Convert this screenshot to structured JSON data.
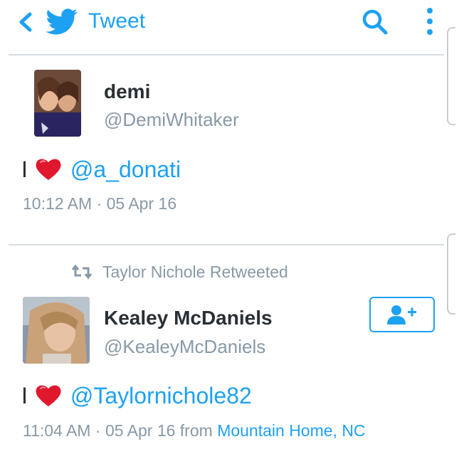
{
  "header": {
    "title": "Tweet",
    "back_icon": "chevron-left-icon",
    "logo_icon": "twitter-bird-icon",
    "search_icon": "search-icon",
    "more_icon": "more-vertical-icon"
  },
  "tweets": [
    {
      "display_name": "demi",
      "handle": "@DemiWhitaker",
      "text_prefix": "I",
      "text_icon": "heart-icon",
      "mention": "@a_donati",
      "time": "10:12 AM",
      "separator": "·",
      "date": "05 Apr 16"
    },
    {
      "retweeted_by": "Taylor Nichole Retweeted",
      "display_name": "Kealey McDaniels",
      "handle": "@KealeyMcDaniels",
      "text_prefix": "I",
      "text_icon": "heart-icon",
      "mention": "@Taylornichole82",
      "time": "11:04 AM",
      "separator": "·",
      "date": "05 Apr 16",
      "from_label": "from",
      "location": "Mountain Home, NC",
      "follow_icon": "add-user-icon"
    }
  ],
  "colors": {
    "accent": "#1da1f2",
    "text": "#292f33",
    "muted": "#8899a6",
    "heart": "#e0182d"
  }
}
